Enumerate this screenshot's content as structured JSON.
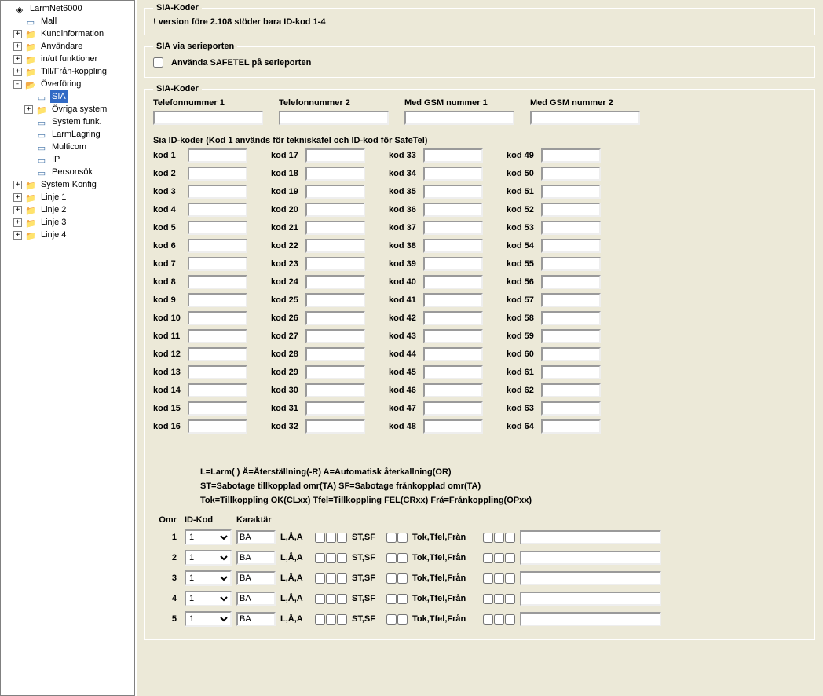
{
  "tree": [
    {
      "indent": 0,
      "toggle": "",
      "icon": "root-icon",
      "label": "LarmNet6000",
      "sel": false
    },
    {
      "indent": 1,
      "toggle": "blank",
      "icon": "page-icon",
      "label": "Mall",
      "sel": false
    },
    {
      "indent": 1,
      "toggle": "+",
      "icon": "folder-closed",
      "label": "Kundinformation",
      "sel": false
    },
    {
      "indent": 1,
      "toggle": "+",
      "icon": "folder-closed",
      "label": "Användare",
      "sel": false
    },
    {
      "indent": 1,
      "toggle": "+",
      "icon": "folder-closed",
      "label": "in/ut funktioner",
      "sel": false
    },
    {
      "indent": 1,
      "toggle": "+",
      "icon": "folder-closed",
      "label": "Till/Från-koppling",
      "sel": false
    },
    {
      "indent": 1,
      "toggle": "-",
      "icon": "folder-open",
      "label": "Överföring",
      "sel": false
    },
    {
      "indent": 2,
      "toggle": "blank",
      "icon": "page-icon",
      "label": "SIA",
      "sel": true
    },
    {
      "indent": 2,
      "toggle": "+",
      "icon": "folder-closed",
      "label": "Övriga system",
      "sel": false
    },
    {
      "indent": 2,
      "toggle": "blank",
      "icon": "page-icon",
      "label": "System funk.",
      "sel": false
    },
    {
      "indent": 2,
      "toggle": "blank",
      "icon": "page-icon",
      "label": "LarmLagring",
      "sel": false
    },
    {
      "indent": 2,
      "toggle": "blank",
      "icon": "page-icon",
      "label": "Multicom",
      "sel": false
    },
    {
      "indent": 2,
      "toggle": "blank",
      "icon": "page-icon",
      "label": "IP",
      "sel": false
    },
    {
      "indent": 2,
      "toggle": "blank",
      "icon": "page-icon",
      "label": "Personsök",
      "sel": false
    },
    {
      "indent": 1,
      "toggle": "+",
      "icon": "folder-closed",
      "label": "System Konfig",
      "sel": false
    },
    {
      "indent": 1,
      "toggle": "+",
      "icon": "folder-closed",
      "label": "Linje 1",
      "sel": false
    },
    {
      "indent": 1,
      "toggle": "+",
      "icon": "folder-closed",
      "label": "Linje 2",
      "sel": false
    },
    {
      "indent": 1,
      "toggle": "+",
      "icon": "folder-closed",
      "label": "Linje 3",
      "sel": false
    },
    {
      "indent": 1,
      "toggle": "+",
      "icon": "folder-closed",
      "label": "Linje 4",
      "sel": false
    }
  ],
  "group1": {
    "legend": "SIA-Koder",
    "warning": "! version före 2.108 stöder bara ID-kod 1-4"
  },
  "group2": {
    "legend": "SIA via serieporten",
    "checkbox_label": "Använda SAFETEL på serieporten"
  },
  "group3": {
    "legend": "SIA-Koder",
    "phones": [
      "Telefonnummer 1",
      "Telefonnummer 2",
      "Med GSM nummer 1",
      "Med GSM nummer 2"
    ],
    "kod_section_label": "Sia ID-koder  (Kod 1 används för tekniskafel och ID-kod för SafeTel)",
    "kod_prefix": "kod"
  },
  "legend_block": {
    "l1": "L=Larm( )  Å=Återställning(-R) A=Automatisk återkallning(OR)",
    "l2": "ST=Sabotage tillkopplad omr(TA)  SF=Sabotage frånkopplad omr(TA)",
    "l3": "Tok=Tillkoppling OK(CLxx) Tfel=Tillkoppling FEL(CRxx) Frå=Frånkoppling(OPxx)"
  },
  "omr_table": {
    "headers": {
      "omr": "Omr",
      "idkod": "ID-Kod",
      "kar": "Karaktär"
    },
    "laa": "L,Å,A",
    "stsf": "ST,SF",
    "tok": "Tok,Tfel,Från",
    "idkod_options": [
      "1"
    ],
    "rows": [
      {
        "omr": "1",
        "idkod": "1",
        "kar": "BA"
      },
      {
        "omr": "2",
        "idkod": "1",
        "kar": "BA"
      },
      {
        "omr": "3",
        "idkod": "1",
        "kar": "BA"
      },
      {
        "omr": "4",
        "idkod": "1",
        "kar": "BA"
      },
      {
        "omr": "5",
        "idkod": "1",
        "kar": "BA"
      }
    ]
  }
}
